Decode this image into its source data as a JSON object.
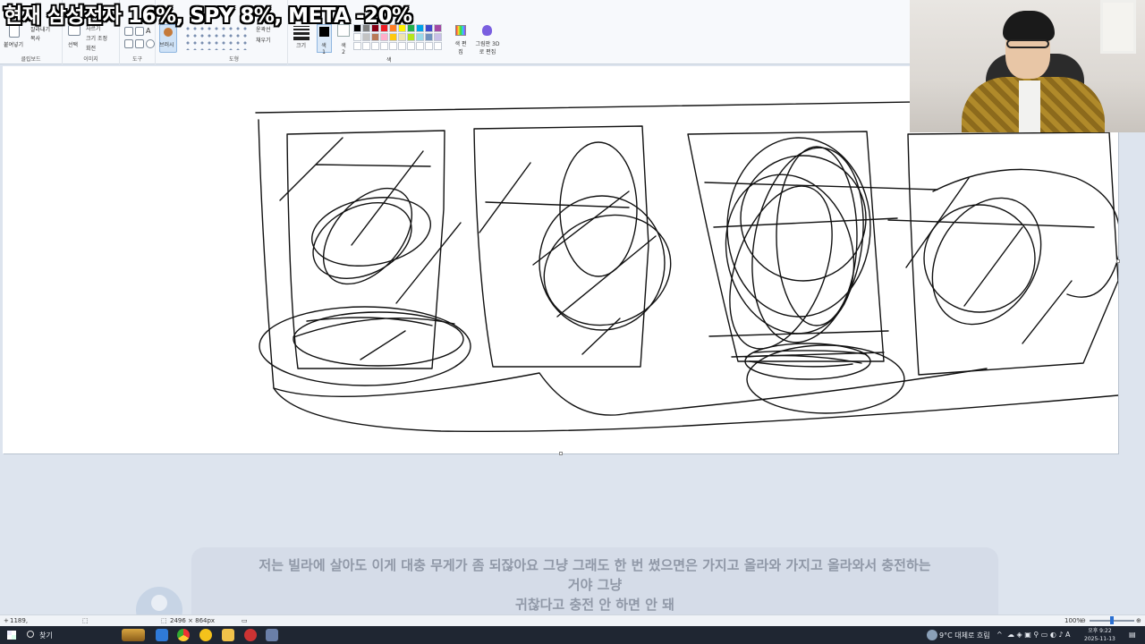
{
  "overlay_title": "현재 삼성전자 16%, SPY 8%, META -20%",
  "ribbon": {
    "clipboard": {
      "paste": "붙여넣기",
      "cut": "잘라내기",
      "copy": "복사",
      "group": "클립보드"
    },
    "image": {
      "select": "선택",
      "crop": "자르기",
      "resize": "크기 조정",
      "rotate": "회전",
      "group": "이미지"
    },
    "tools": {
      "group": "도구"
    },
    "brush": {
      "label": "브러시"
    },
    "shapes": {
      "outline": "윤곽선",
      "fill": "채우기",
      "group": "도형"
    },
    "size": {
      "label": "크기"
    },
    "color1": {
      "label": "색 1"
    },
    "color2": {
      "label": "색 2"
    },
    "colors": {
      "edit": "색 편집",
      "group": "색"
    },
    "paint3d": {
      "label": "그림판 3D로 편집"
    }
  },
  "palette_colors": [
    "#000000",
    "#7f7f7f",
    "#880015",
    "#ed1c24",
    "#ff7f27",
    "#fff200",
    "#22b14c",
    "#00a2e8",
    "#3f48cc",
    "#a349a4",
    "#ffffff",
    "#c3c3c3",
    "#b97a57",
    "#ffaec9",
    "#ffc90e",
    "#efe4b0",
    "#b5e61d",
    "#99d9ea",
    "#7092be",
    "#c8bfe7",
    "#ffffff",
    "#ffffff",
    "#ffffff",
    "#ffffff",
    "#ffffff",
    "#ffffff",
    "#ffffff",
    "#ffffff",
    "#ffffff",
    "#ffffff"
  ],
  "subtitle": {
    "line1": "저는 빌라에 살아도 이게 대충 무게가 좀 되잖아요 그냥 그래도 한 번 썼으면은 가지고 올라와 가지고 올라와서 충전하는",
    "line2": "거야 그냥",
    "line3": "귀찮다고 충전 안 하면 안 돼"
  },
  "statusbar": {
    "cursor": "1189,",
    "canvas_size": "2496 × 864px",
    "filesize": "",
    "zoom": "100%"
  },
  "taskbar": {
    "search": "찾기",
    "weather": "9°C 대체로 흐림",
    "time": "오후 9:22",
    "date": "2025-11-13"
  }
}
